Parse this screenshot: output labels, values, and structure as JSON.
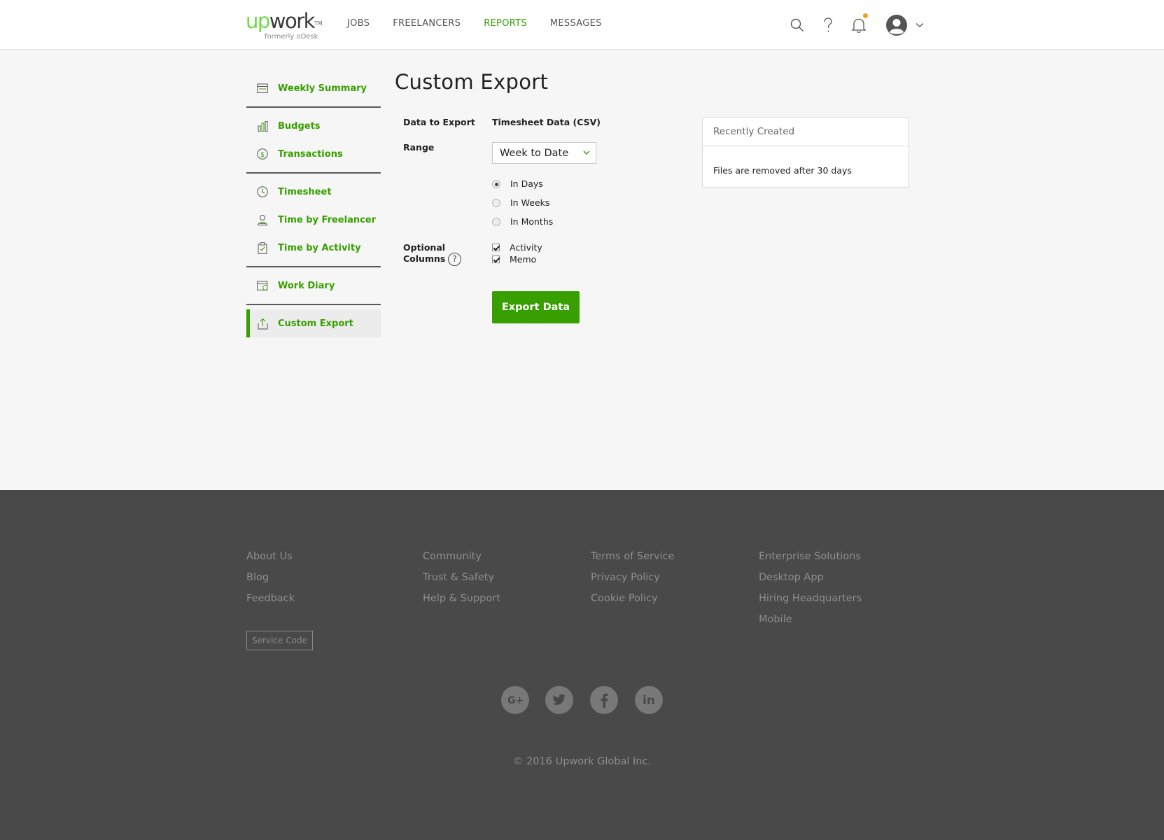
{
  "header": {
    "logo_up": "up",
    "logo_work": "work",
    "logo_tm": "TM",
    "logo_sub": "formerly oDesk",
    "nav": [
      {
        "label": "JOBS",
        "active": false
      },
      {
        "label": "FREELANCERS",
        "active": false
      },
      {
        "label": "REPORTS",
        "active": true
      },
      {
        "label": "MESSAGES",
        "active": false
      }
    ],
    "icons": [
      "search-icon",
      "help-icon",
      "bell-icon",
      "avatar-icon",
      "chevron-down-icon"
    ],
    "notification_dot_color": "#f1a11e"
  },
  "sidebar": {
    "items": [
      {
        "label": "Weekly Summary",
        "icon": "calendar-icon"
      },
      {
        "label": "Budgets",
        "icon": "bar-chart-icon"
      },
      {
        "label": "Transactions",
        "icon": "dollar-circle-icon"
      },
      {
        "label": "Timesheet",
        "icon": "clock-icon"
      },
      {
        "label": "Time by Freelancer",
        "icon": "person-icon"
      },
      {
        "label": "Time by Activity",
        "icon": "clipboard-icon"
      },
      {
        "label": "Work Diary",
        "icon": "diary-icon"
      },
      {
        "label": "Custom Export",
        "icon": "upload-icon",
        "active": true
      }
    ]
  },
  "main": {
    "title": "Custom Export",
    "data_to_export_label": "Data to Export",
    "data_to_export_value": "Timesheet Data (CSV)",
    "range_label": "Range",
    "range_select": "Week to Date",
    "range_options": [
      {
        "label": "In Days",
        "checked": true
      },
      {
        "label": "In Weeks",
        "checked": false
      },
      {
        "label": "In Months",
        "checked": false
      }
    ],
    "optional_label_1": "Optional",
    "optional_label_2": "Columns",
    "help_glyph": "?",
    "optional_columns": [
      {
        "label": "Activity",
        "checked": true
      },
      {
        "label": "Memo",
        "checked": true
      }
    ],
    "export_button": "Export Data"
  },
  "recent": {
    "title": "Recently Created",
    "note": "Files are removed after 30 days"
  },
  "footer": {
    "col1": [
      "About Us",
      "Blog",
      "Feedback"
    ],
    "col2": [
      "Community",
      "Trust & Safety",
      "Help & Support"
    ],
    "col3": [
      "Terms of Service",
      "Privacy Policy",
      "Cookie Policy"
    ],
    "col4": [
      "Enterprise Solutions",
      "Desktop App",
      "Hiring Headquarters",
      "Mobile"
    ],
    "service_code": "Service Code",
    "social": [
      "google-plus-icon",
      "twitter-icon",
      "facebook-icon",
      "linkedin-icon"
    ],
    "copyright": "© 2016 Upwork Global Inc."
  },
  "colors": {
    "brand_green": "#37a000",
    "logo_green": "#6fda44",
    "footer_bg": "#494949"
  }
}
